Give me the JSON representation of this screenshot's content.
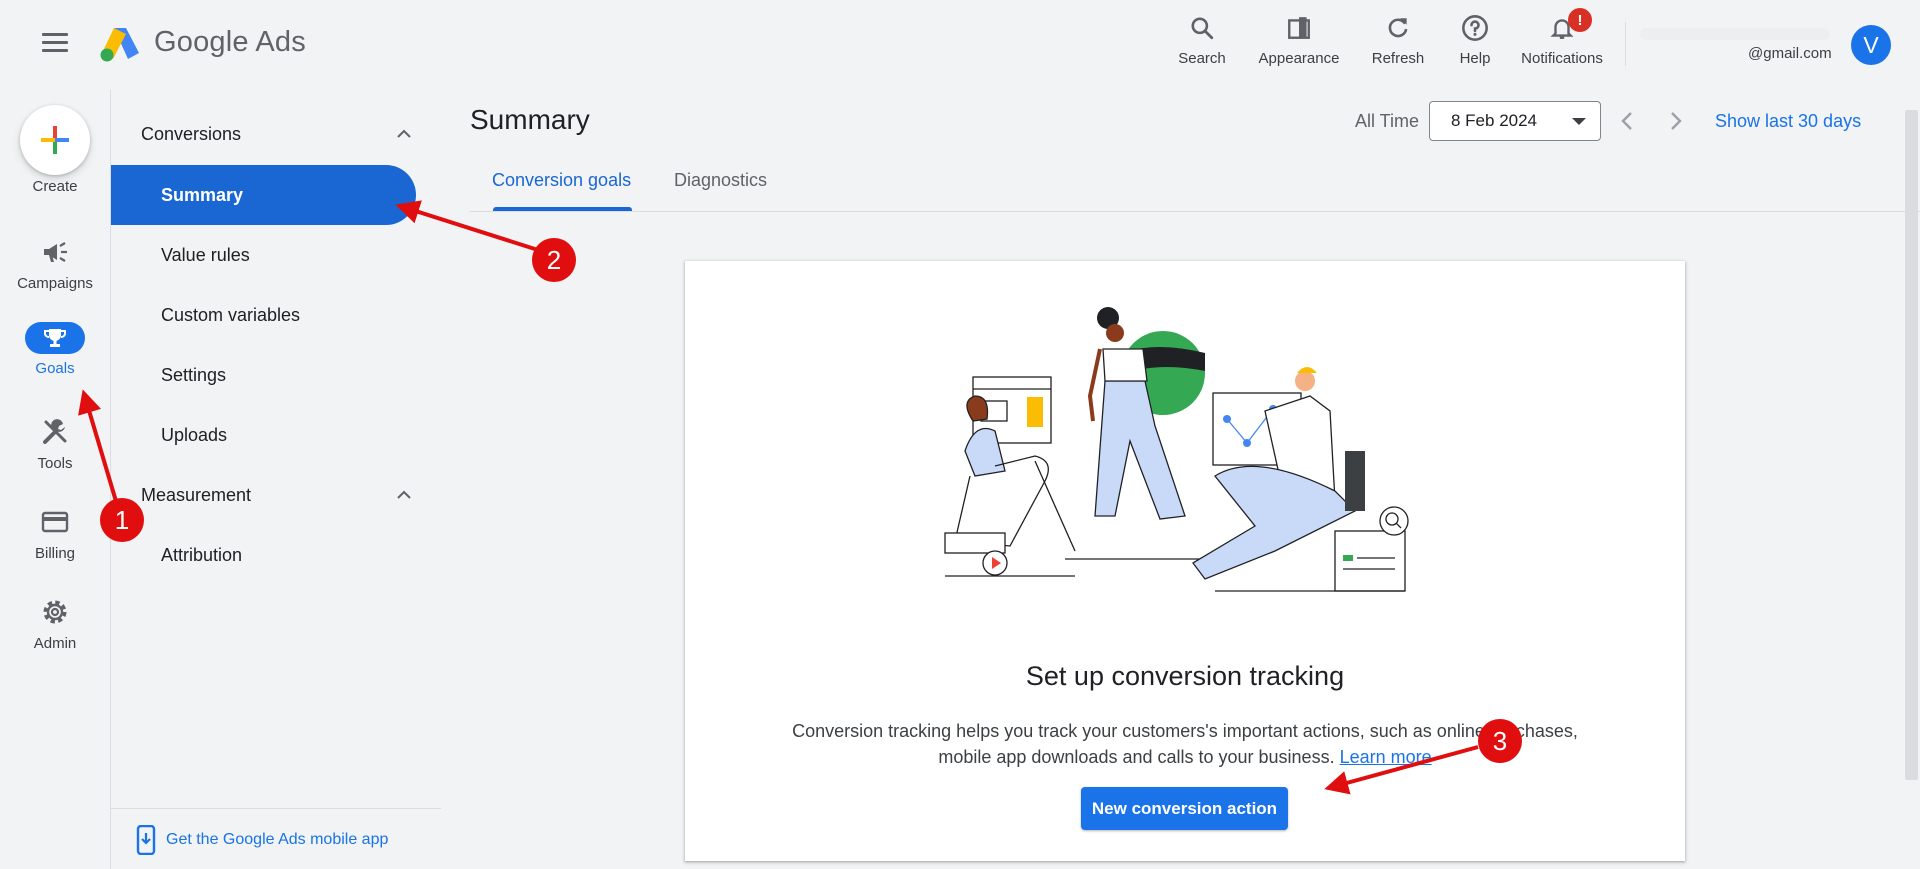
{
  "header": {
    "brand_google": "Google",
    "brand_ads": "Ads",
    "actions": [
      {
        "label": "Search",
        "icon": "search-icon"
      },
      {
        "label": "Appearance",
        "icon": "appearance-icon"
      },
      {
        "label": "Refresh",
        "icon": "refresh-icon"
      },
      {
        "label": "Help",
        "icon": "help-icon"
      },
      {
        "label": "Notifications",
        "icon": "bell-icon"
      }
    ],
    "notification_badge": "!",
    "account_email": "@gmail.com",
    "avatar_letter": "V"
  },
  "rail": {
    "create": "Create",
    "items": [
      {
        "label": "Campaigns",
        "icon": "megaphone-icon"
      },
      {
        "label": "Goals",
        "icon": "trophy-icon",
        "active": true
      },
      {
        "label": "Tools",
        "icon": "tools-icon"
      },
      {
        "label": "Billing",
        "icon": "credit-card-icon"
      },
      {
        "label": "Admin",
        "icon": "gear-icon"
      }
    ]
  },
  "subnav": {
    "groups": [
      {
        "label": "Conversions",
        "items": [
          "Summary",
          "Value rules",
          "Custom variables",
          "Settings",
          "Uploads"
        ]
      },
      {
        "label": "Measurement",
        "items": [
          "Attribution"
        ]
      }
    ],
    "active_item": "Summary",
    "mobile_app_link": "Get the Google Ads mobile app"
  },
  "main": {
    "title": "Summary",
    "all_time": "All Time",
    "date_value": "8 Feb 2024",
    "show_last": "Show last 30 days",
    "tabs": [
      {
        "label": "Conversion goals",
        "active": true
      },
      {
        "label": "Diagnostics",
        "active": false
      }
    ],
    "empty_state": {
      "title": "Set up conversion tracking",
      "desc_line1": "Conversion tracking helps you track your customers's important actions, such as online purchases,",
      "desc_line2": "mobile app downloads and calls to your business.",
      "learn_more": "Learn more",
      "button": "New conversion action"
    }
  },
  "annotations": {
    "markers": [
      "1",
      "2",
      "3"
    ],
    "color": "#e00e0e"
  },
  "colors": {
    "accent": "#1a73e8",
    "active_nav": "#1a66d2",
    "background": "#f1f3f4"
  }
}
